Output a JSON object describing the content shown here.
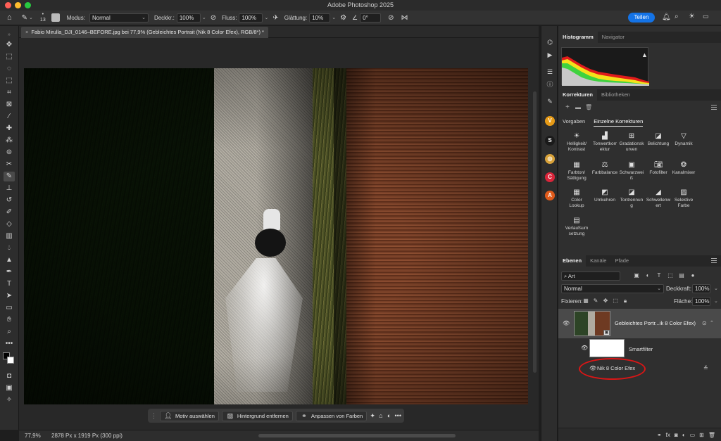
{
  "window": {
    "title": "Adobe Photoshop 2025"
  },
  "options_bar": {
    "brush_size": "13",
    "mode_label": "Modus:",
    "mode_value": "Normal",
    "opacity_label": "Deckkr.:",
    "opacity_value": "100%",
    "flow_label": "Fluss:",
    "flow_value": "100%",
    "smoothing_label": "Glättung:",
    "smoothing_value": "10%",
    "angle_value": "0°",
    "share_label": "Teilen"
  },
  "document": {
    "tab_title": "Fabio Mirulla_DJI_0146–BEFORE.jpg bei 77,9% (Gebleichtes Portrait (Nik 8 Color Efex), RGB/8*) *"
  },
  "status": {
    "zoom": "77,9%",
    "dimensions": "2878 Px x 1919 Px (300 ppi)"
  },
  "taskbar": {
    "select_subject": "Motiv auswählen",
    "remove_background": "Hintergrund entfernen",
    "adjust_colors": "Anpassen von Farben"
  },
  "panels": {
    "histogram_tab": "Histogramm",
    "navigator_tab": "Navigator",
    "corrections_tab": "Korrekturen",
    "libraries_tab": "Bibliotheken",
    "presets_tab": "Vorgaben",
    "single_corrections_tab": "Einzelne Korrekturen",
    "adjustments": [
      {
        "label": "Helligkeit/\nKontrast",
        "icon": "brightness-icon"
      },
      {
        "label": "Tonwertkorr\nektur",
        "icon": "levels-icon"
      },
      {
        "label": "Gradationsk\nurven",
        "icon": "curves-icon"
      },
      {
        "label": "Belichtung",
        "icon": "exposure-icon"
      },
      {
        "label": "Dynamik",
        "icon": "vibrance-icon"
      },
      {
        "label": "Farbton/\nSättigung",
        "icon": "hue-saturation-icon"
      },
      {
        "label": "Farbbalance",
        "icon": "color-balance-icon"
      },
      {
        "label": "Schwarzwei\nß",
        "icon": "black-white-icon"
      },
      {
        "label": "Fotofilter",
        "icon": "photo-filter-icon"
      },
      {
        "label": "Kanalmixer",
        "icon": "channel-mixer-icon"
      },
      {
        "label": "Color\nLookup",
        "icon": "color-lookup-icon"
      },
      {
        "label": "Umkehren",
        "icon": "invert-icon"
      },
      {
        "label": "Tontrennun\ng",
        "icon": "posterize-icon"
      },
      {
        "label": "Schwellenw\nert",
        "icon": "threshold-icon"
      },
      {
        "label": "Selektive\nFarbe",
        "icon": "selective-color-icon"
      },
      {
        "label": "Verlaufsum\nsetzung",
        "icon": "gradient-map-icon"
      }
    ],
    "layers_tab": "Ebenen",
    "channels_tab": "Kanäle",
    "paths_tab": "Pfade",
    "kind_filter": "Art",
    "blend_mode": "Normal",
    "opacity_label": "Deckkraft:",
    "opacity_value": "100%",
    "lock_label": "Fixieren:",
    "fill_label": "Fläche:",
    "fill_value": "100%",
    "layer_name": "Gebleichtes Portr...ik 8 Color Efex)",
    "smartfilter_label": "Smartfilter",
    "filter_name": "Nik 8 Color Efex"
  },
  "colors": {
    "accent": "#1473e6",
    "highlight_ellipse": "#d91616"
  }
}
